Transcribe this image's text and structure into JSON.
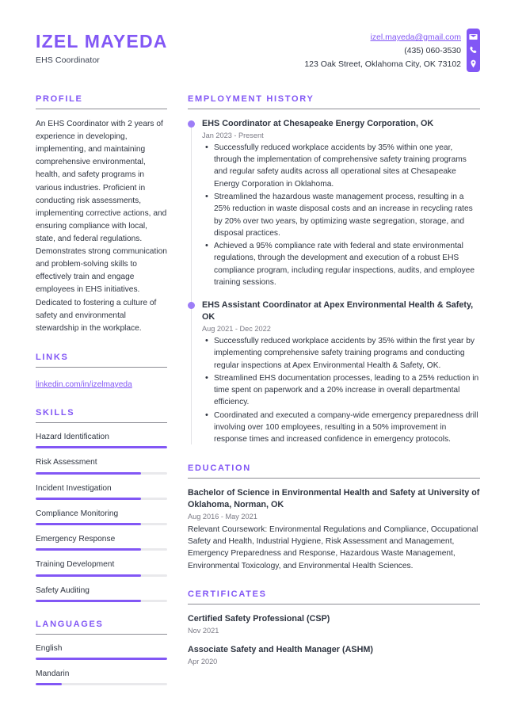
{
  "header": {
    "full_name": "IZEL MAYEDA",
    "job_title": "EHS Coordinator",
    "email": "izel.mayeda@gmail.com",
    "phone": "(435) 060-3530",
    "address": "123 Oak Street, Oklahoma City, OK 73102",
    "icons": [
      "envelope-icon",
      "phone-icon",
      "location-pin-icon"
    ]
  },
  "theme": {
    "accent": "#8257f5",
    "accent_light": "#9d7df7",
    "text": "#2e3440",
    "muted": "#7a7a85",
    "rule": "#8b8b93",
    "track": "#e9e9ec"
  },
  "left": {
    "profile": {
      "heading": "PROFILE",
      "text": "An EHS Coordinator with 2 years of experience in developing, implementing, and maintaining comprehensive environmental, health, and safety programs in various industries. Proficient in conducting risk assessments, implementing corrective actions, and ensuring compliance with local, state, and federal regulations. Demonstrates strong communication and problem-solving skills to effectively train and engage employees in EHS initiatives. Dedicated to fostering a culture of safety and environmental stewardship in the workplace."
    },
    "links": {
      "heading": "LINKS",
      "items": [
        {
          "label": "linkedin.com/in/izelmayeda"
        }
      ]
    },
    "skills": {
      "heading": "SKILLS",
      "items": [
        {
          "label": "Hazard Identification",
          "level": 100
        },
        {
          "label": "Risk Assessment",
          "level": 80
        },
        {
          "label": "Incident Investigation",
          "level": 80
        },
        {
          "label": "Compliance Monitoring",
          "level": 80
        },
        {
          "label": "Emergency Response",
          "level": 80
        },
        {
          "label": "Training Development",
          "level": 80
        },
        {
          "label": "Safety Auditing",
          "level": 80
        }
      ]
    },
    "languages": {
      "heading": "LANGUAGES",
      "items": [
        {
          "label": "English",
          "level": 100
        },
        {
          "label": "Mandarin",
          "level": 20
        }
      ]
    }
  },
  "right": {
    "employment": {
      "heading": "EMPLOYMENT HISTORY",
      "entries": [
        {
          "title": "EHS Coordinator at Chesapeake Energy Corporation, OK",
          "date": "Jan 2023 - Present",
          "bullets": [
            "Successfully reduced workplace accidents by 35% within one year, through the implementation of comprehensive safety training programs and regular safety audits across all operational sites at Chesapeake Energy Corporation in Oklahoma.",
            "Streamlined the hazardous waste management process, resulting in a 25% reduction in waste disposal costs and an increase in recycling rates by 20% over two years, by optimizing waste segregation, storage, and disposal practices.",
            "Achieved a 95% compliance rate with federal and state environmental regulations, through the development and execution of a robust EHS compliance program, including regular inspections, audits, and employee training sessions."
          ]
        },
        {
          "title": "EHS Assistant Coordinator at Apex Environmental Health & Safety, OK",
          "date": "Aug 2021 - Dec 2022",
          "bullets": [
            "Successfully reduced workplace accidents by 35% within the first year by implementing comprehensive safety training programs and conducting regular inspections at Apex Environmental Health & Safety, OK.",
            "Streamlined EHS documentation processes, leading to a 25% reduction in time spent on paperwork and a 20% increase in overall departmental efficiency.",
            "Coordinated and executed a company-wide emergency preparedness drill involving over 100 employees, resulting in a 50% improvement in response times and increased confidence in emergency protocols."
          ]
        }
      ]
    },
    "education": {
      "heading": "EDUCATION",
      "entries": [
        {
          "title": "Bachelor of Science in Environmental Health and Safety at University of Oklahoma, Norman, OK",
          "date": "Aug 2016 - May 2021",
          "description": "Relevant Coursework: Environmental Regulations and Compliance, Occupational Safety and Health, Industrial Hygiene, Risk Assessment and Management, Emergency Preparedness and Response, Hazardous Waste Management, Environmental Toxicology, and Environmental Health Sciences."
        }
      ]
    },
    "certificates": {
      "heading": "CERTIFICATES",
      "entries": [
        {
          "title": "Certified Safety Professional (CSP)",
          "date": "Nov 2021",
          "description": ""
        },
        {
          "title": "Associate Safety and Health Manager (ASHM)",
          "date": "Apr 2020",
          "description": ""
        }
      ]
    }
  }
}
